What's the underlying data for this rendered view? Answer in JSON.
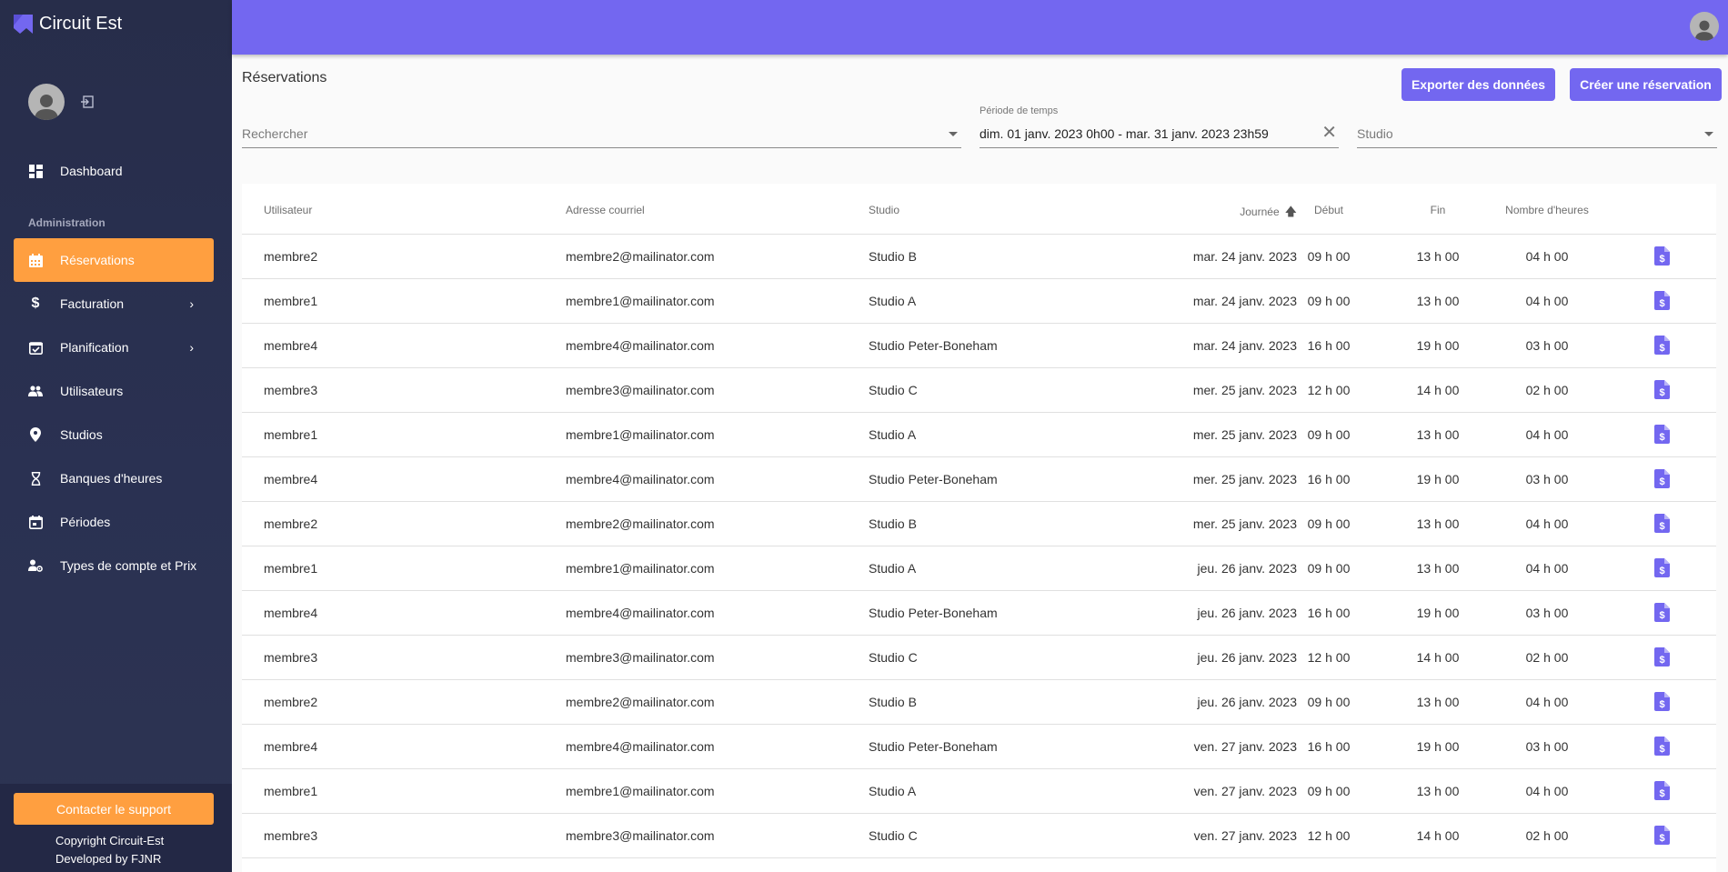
{
  "app": {
    "name": "Circuit Est",
    "brand_color": "#7367f0",
    "accent_color": "#ff9f40"
  },
  "sidebar": {
    "logout_icon": "logout-icon",
    "section_label": "Administration",
    "items": [
      {
        "label": "Dashboard",
        "icon": "dashboard-icon",
        "active": false,
        "has_submenu": false
      },
      {
        "label": "Réservations",
        "icon": "calendar-icon",
        "active": true,
        "has_submenu": false
      },
      {
        "label": "Facturation",
        "icon": "dollar-icon",
        "active": false,
        "has_submenu": true
      },
      {
        "label": "Planification",
        "icon": "calendar-check-icon",
        "active": false,
        "has_submenu": true
      },
      {
        "label": "Utilisateurs",
        "icon": "users-icon",
        "active": false,
        "has_submenu": false
      },
      {
        "label": "Studios",
        "icon": "map-pin-icon",
        "active": false,
        "has_submenu": false
      },
      {
        "label": "Banques d'heures",
        "icon": "hourglass-icon",
        "active": false,
        "has_submenu": false
      },
      {
        "label": "Périodes",
        "icon": "calendar-period-icon",
        "active": false,
        "has_submenu": false
      },
      {
        "label": "Types de compte et Prix",
        "icon": "user-settings-icon",
        "active": false,
        "has_submenu": false
      }
    ],
    "support_button": "Contacter le support",
    "copyright": "Copyright Circuit-Est",
    "developer": "Developed by FJNR"
  },
  "page": {
    "title": "Réservations",
    "export_button": "Exporter des données",
    "create_button": "Créer une réservation"
  },
  "filters": {
    "search_placeholder": "Rechercher",
    "period_label": "Période de temps",
    "period_value": "dim. 01 janv. 2023 0h00 - mar. 31 janv. 2023 23h59",
    "studio_placeholder": "Studio"
  },
  "table": {
    "columns": {
      "user": "Utilisateur",
      "email": "Adresse courriel",
      "studio": "Studio",
      "day": "Journée",
      "start": "Début",
      "end": "Fin",
      "hours": "Nombre d'heures"
    },
    "sort": {
      "column": "day",
      "direction": "ascending"
    },
    "action_icon": "invoice-dollar-icon",
    "rows": [
      {
        "user": "membre2",
        "email": "membre2@mailinator.com",
        "studio": "Studio B",
        "day": "mar. 24 janv. 2023",
        "start": "09 h 00",
        "end": "13 h 00",
        "hours": "04 h 00"
      },
      {
        "user": "membre1",
        "email": "membre1@mailinator.com",
        "studio": "Studio A",
        "day": "mar. 24 janv. 2023",
        "start": "09 h 00",
        "end": "13 h 00",
        "hours": "04 h 00"
      },
      {
        "user": "membre4",
        "email": "membre4@mailinator.com",
        "studio": "Studio Peter-Boneham",
        "day": "mar. 24 janv. 2023",
        "start": "16 h 00",
        "end": "19 h 00",
        "hours": "03 h 00"
      },
      {
        "user": "membre3",
        "email": "membre3@mailinator.com",
        "studio": "Studio C",
        "day": "mer. 25 janv. 2023",
        "start": "12 h 00",
        "end": "14 h 00",
        "hours": "02 h 00"
      },
      {
        "user": "membre1",
        "email": "membre1@mailinator.com",
        "studio": "Studio A",
        "day": "mer. 25 janv. 2023",
        "start": "09 h 00",
        "end": "13 h 00",
        "hours": "04 h 00"
      },
      {
        "user": "membre4",
        "email": "membre4@mailinator.com",
        "studio": "Studio Peter-Boneham",
        "day": "mer. 25 janv. 2023",
        "start": "16 h 00",
        "end": "19 h 00",
        "hours": "03 h 00"
      },
      {
        "user": "membre2",
        "email": "membre2@mailinator.com",
        "studio": "Studio B",
        "day": "mer. 25 janv. 2023",
        "start": "09 h 00",
        "end": "13 h 00",
        "hours": "04 h 00"
      },
      {
        "user": "membre1",
        "email": "membre1@mailinator.com",
        "studio": "Studio A",
        "day": "jeu. 26 janv. 2023",
        "start": "09 h 00",
        "end": "13 h 00",
        "hours": "04 h 00"
      },
      {
        "user": "membre4",
        "email": "membre4@mailinator.com",
        "studio": "Studio Peter-Boneham",
        "day": "jeu. 26 janv. 2023",
        "start": "16 h 00",
        "end": "19 h 00",
        "hours": "03 h 00"
      },
      {
        "user": "membre3",
        "email": "membre3@mailinator.com",
        "studio": "Studio C",
        "day": "jeu. 26 janv. 2023",
        "start": "12 h 00",
        "end": "14 h 00",
        "hours": "02 h 00"
      },
      {
        "user": "membre2",
        "email": "membre2@mailinator.com",
        "studio": "Studio B",
        "day": "jeu. 26 janv. 2023",
        "start": "09 h 00",
        "end": "13 h 00",
        "hours": "04 h 00"
      },
      {
        "user": "membre4",
        "email": "membre4@mailinator.com",
        "studio": "Studio Peter-Boneham",
        "day": "ven. 27 janv. 2023",
        "start": "16 h 00",
        "end": "19 h 00",
        "hours": "03 h 00"
      },
      {
        "user": "membre1",
        "email": "membre1@mailinator.com",
        "studio": "Studio A",
        "day": "ven. 27 janv. 2023",
        "start": "09 h 00",
        "end": "13 h 00",
        "hours": "04 h 00"
      },
      {
        "user": "membre3",
        "email": "membre3@mailinator.com",
        "studio": "Studio C",
        "day": "ven. 27 janv. 2023",
        "start": "12 h 00",
        "end": "14 h 00",
        "hours": "02 h 00"
      }
    ]
  }
}
